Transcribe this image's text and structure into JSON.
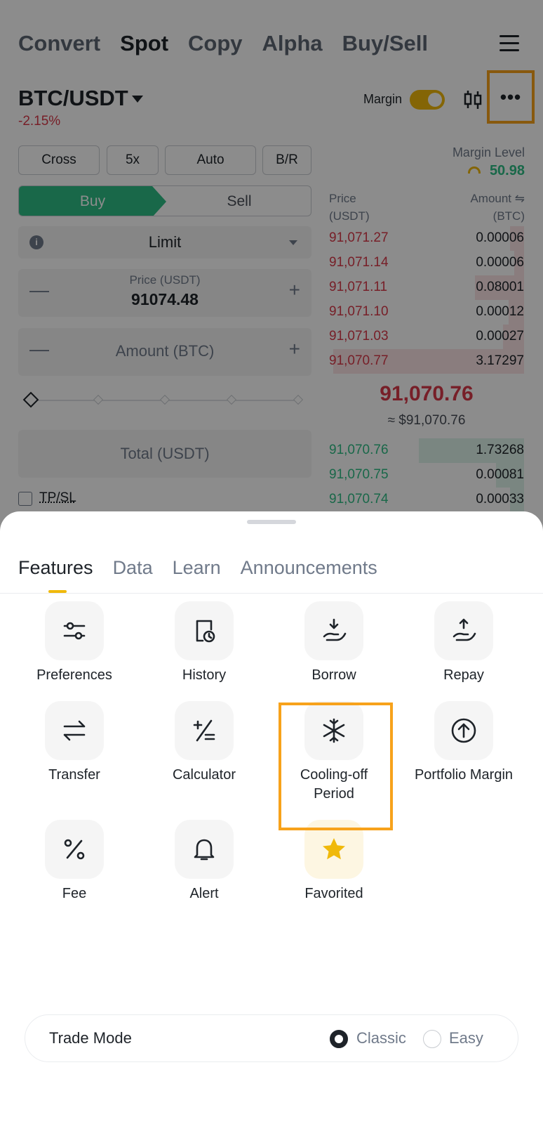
{
  "top_nav": [
    "Convert",
    "Spot",
    "Copy",
    "Alpha",
    "Buy/Sell"
  ],
  "pair": "BTC/USDT",
  "change": "-2.15%",
  "margin_label": "Margin",
  "more_icon": "•••",
  "chips": [
    "Cross",
    "5x",
    "Auto",
    "B/R"
  ],
  "buy": "Buy",
  "sell": "Sell",
  "info_icon": "i",
  "order_type": "Limit",
  "price_label": "Price (USDT)",
  "price_value": "91074.48",
  "amount_placeholder": "Amount (BTC)",
  "total_placeholder": "Total (USDT)",
  "tpsl": "TP/SL",
  "minus_sign": "—",
  "plus_sign": "+",
  "margin_level_label": "Margin Level",
  "margin_level_value": "50.98",
  "orderbook": {
    "price_head": "Price\n(USDT)",
    "amount_head": "Amount ⇋\n(BTC)",
    "asks": [
      {
        "price": "91,071.27",
        "amount": "0.00006"
      },
      {
        "price": "91,071.14",
        "amount": "0.00006"
      },
      {
        "price": "91,071.11",
        "amount": "0.08001"
      },
      {
        "price": "91,071.10",
        "amount": "0.00012"
      },
      {
        "price": "91,071.03",
        "amount": "0.00027"
      },
      {
        "price": "91,070.77",
        "amount": "3.17297"
      }
    ],
    "mid_price": "91,070.76",
    "mid_usd": "≈ $91,070.76",
    "bids": [
      {
        "price": "91,070.76",
        "amount": "1.73268"
      },
      {
        "price": "91,070.75",
        "amount": "0.00081"
      },
      {
        "price": "91,070.74",
        "amount": "0.00033"
      }
    ]
  },
  "sheet": {
    "tabs": [
      "Features",
      "Data",
      "Learn",
      "Announcements"
    ],
    "features": [
      {
        "label": "Preferences",
        "icon": "sliders-icon"
      },
      {
        "label": "History",
        "icon": "history-icon"
      },
      {
        "label": "Borrow",
        "icon": "borrow-icon"
      },
      {
        "label": "Repay",
        "icon": "repay-icon"
      },
      {
        "label": "Transfer",
        "icon": "transfer-icon"
      },
      {
        "label": "Calculator",
        "icon": "calculator-icon"
      },
      {
        "label": "Cooling-off Period",
        "icon": "snowflake-icon"
      },
      {
        "label": "Portfolio Margin",
        "icon": "arrow-up-circle-icon"
      },
      {
        "label": "Fee",
        "icon": "percent-icon"
      },
      {
        "label": "Alert",
        "icon": "bell-icon"
      },
      {
        "label": "Favorited",
        "icon": "star-icon"
      }
    ],
    "trade_mode": {
      "label": "Trade Mode",
      "options": [
        "Classic",
        "Easy"
      ],
      "selected": "Classic"
    }
  },
  "colors": {
    "accent": "#f0b90b",
    "buy": "#2ebd85",
    "sell": "#d93949",
    "highlight": "#f7a21b"
  }
}
